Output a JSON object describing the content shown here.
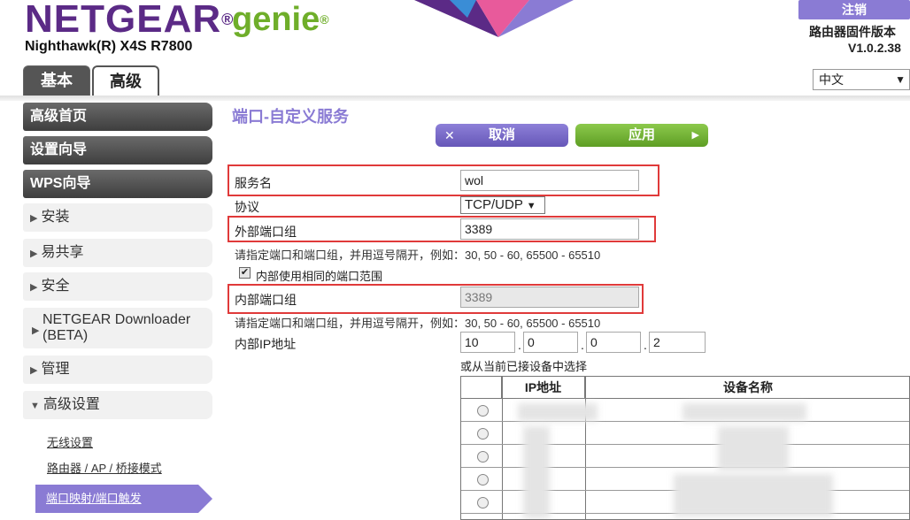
{
  "header": {
    "brand": "NETGEAR",
    "brand_mark": "®",
    "product": "genie",
    "product_mark": "®",
    "model": "Nighthawk(R) X4S R7800",
    "logout": "注销",
    "firmware_label": "路由器固件版本",
    "firmware_version": "V1.0.2.38",
    "language": "中文"
  },
  "tabs": [
    {
      "label": "基本"
    },
    {
      "label": "高级"
    }
  ],
  "sidebar": {
    "main_items": [
      "高级首页",
      "设置向导",
      "WPS向导"
    ],
    "groups": [
      "安装",
      "易共享",
      "安全",
      "NETGEAR Downloader (BETA)",
      "管理",
      "高级设置"
    ],
    "sub_items": [
      "无线设置",
      "路由器 / AP / 桥接模式",
      "端口映射/端口触发"
    ],
    "active": "端口映射/端口触发"
  },
  "form": {
    "title": "端口-自定义服务",
    "cancel": "取消",
    "apply": "应用",
    "service_name_label": "服务名",
    "service_name": "wol",
    "protocol_label": "协议",
    "protocol": "TCP/UDP",
    "external_port_label": "外部端口组",
    "external_port": "3389",
    "hint": "请指定端口和端口组，并用逗号隔开，例如：30, 50 - 60, 65500 - 65510",
    "same_range_label": "内部使用相同的端口范围",
    "same_range_checked": true,
    "internal_port_label": "内部端口组",
    "internal_port": "3389",
    "internal_ip_label": "内部IP地址",
    "ip": [
      "10",
      "0",
      "0",
      "2"
    ],
    "choose_label": "或从当前已接设备中选择"
  },
  "table": {
    "headers": [
      "IP地址",
      "设备名称"
    ],
    "row_count": 5
  },
  "colors": {
    "brand_purple": "#5b2a86",
    "accent_purple": "#8a7bd4",
    "genie_green": "#6fae2a",
    "highlight_red": "#e03a3a"
  }
}
